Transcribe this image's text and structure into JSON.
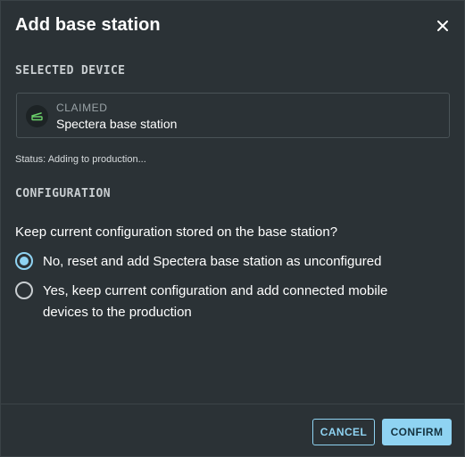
{
  "dialog": {
    "title": "Add base station",
    "close_icon": "close-icon"
  },
  "selected_device": {
    "section_label": "SELECTED DEVICE",
    "claim_status": "CLAIMED",
    "device_name": "Spectera base station",
    "icon": "base-station-icon",
    "icon_color": "#6bd16b"
  },
  "status": {
    "text": "Status: Adding to production..."
  },
  "configuration": {
    "section_label": "CONFIGURATION",
    "question": "Keep current configuration stored on the base station?",
    "options": [
      {
        "label": "No, reset and add Spectera base station as unconfigured",
        "selected": true
      },
      {
        "label": "Yes, keep current configuration and add connected mobile devices to the production",
        "selected": false
      }
    ]
  },
  "footer": {
    "cancel_label": "CANCEL",
    "confirm_label": "CONFIRM"
  },
  "colors": {
    "accent": "#8fd3f2",
    "background": "#2b3236",
    "device_icon": "#6bd16b"
  }
}
